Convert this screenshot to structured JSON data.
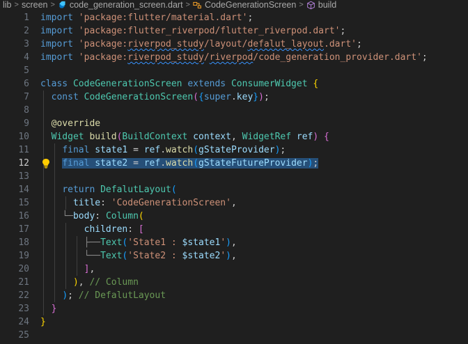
{
  "breadcrumb": {
    "items": [
      {
        "label": "lib",
        "icon": "none"
      },
      {
        "label": "screen",
        "icon": "none"
      },
      {
        "label": "code_generation_screen.dart",
        "icon": "dart-file-icon"
      },
      {
        "label": "CodeGenerationScreen",
        "icon": "class-symbol-icon"
      },
      {
        "label": "build",
        "icon": "method-cube-icon"
      }
    ],
    "separator": ">"
  },
  "editor": {
    "current_line": 12,
    "lines": [
      {
        "n": "1",
        "tokens": [
          [
            "import",
            "k"
          ],
          [
            " ",
            "p"
          ],
          [
            "'package:flutter/material.dart'",
            "s"
          ],
          [
            ";",
            "p"
          ]
        ]
      },
      {
        "n": "2",
        "tokens": [
          [
            "import",
            "k"
          ],
          [
            " ",
            "p"
          ],
          [
            "'package:flutter_riverpod/flutter_riverpod.dart'",
            "s"
          ],
          [
            ";",
            "p"
          ]
        ]
      },
      {
        "n": "3",
        "tokens": [
          [
            "import",
            "k"
          ],
          [
            " ",
            "p"
          ],
          [
            "'package:",
            "s"
          ],
          [
            "riverpod_study",
            "s sq"
          ],
          [
            "/layout/",
            "s"
          ],
          [
            "defalut_layout",
            "s sq"
          ],
          [
            ".dart'",
            "s"
          ],
          [
            ";",
            "p"
          ]
        ]
      },
      {
        "n": "4",
        "tokens": [
          [
            "import",
            "k"
          ],
          [
            " ",
            "p"
          ],
          [
            "'package:",
            "s"
          ],
          [
            "riverpod_study",
            "s sq"
          ],
          [
            "/",
            "s"
          ],
          [
            "riverpod",
            "s sq"
          ],
          [
            "/code_generation_provider.dart'",
            "s"
          ],
          [
            ";",
            "p"
          ]
        ]
      },
      {
        "n": "5",
        "tokens": []
      },
      {
        "n": "6",
        "tokens": [
          [
            "class",
            "k"
          ],
          [
            " ",
            "p"
          ],
          [
            "CodeGenerationScreen",
            "t"
          ],
          [
            " ",
            "p"
          ],
          [
            "extends",
            "k"
          ],
          [
            " ",
            "p"
          ],
          [
            "ConsumerWidget",
            "t"
          ],
          [
            " ",
            "p"
          ],
          [
            "{",
            "b1"
          ]
        ]
      },
      {
        "n": "7",
        "tokens": [
          [
            "  ",
            "p"
          ],
          [
            "const",
            "k"
          ],
          [
            " ",
            "p"
          ],
          [
            "CodeGenerationScreen",
            "t"
          ],
          [
            "(",
            "b2"
          ],
          [
            "{",
            "b3"
          ],
          [
            "super",
            "k"
          ],
          [
            ".",
            "p"
          ],
          [
            "key",
            "v"
          ],
          [
            "}",
            "b3"
          ],
          [
            ")",
            "b2"
          ],
          [
            ";",
            "p"
          ]
        ]
      },
      {
        "n": "8",
        "tokens": []
      },
      {
        "n": "9",
        "tokens": [
          [
            "  ",
            "p"
          ],
          [
            "@override",
            "f"
          ]
        ]
      },
      {
        "n": "10",
        "tokens": [
          [
            "  ",
            "p"
          ],
          [
            "Widget",
            "t"
          ],
          [
            " ",
            "p"
          ],
          [
            "build",
            "f"
          ],
          [
            "(",
            "b2"
          ],
          [
            "BuildContext",
            "t"
          ],
          [
            " ",
            "p"
          ],
          [
            "context",
            "v"
          ],
          [
            ", ",
            "p"
          ],
          [
            "WidgetRef",
            "t"
          ],
          [
            " ",
            "p"
          ],
          [
            "ref",
            "v"
          ],
          [
            ")",
            "b2"
          ],
          [
            " ",
            "p"
          ],
          [
            "{",
            "b2"
          ]
        ]
      },
      {
        "n": "11",
        "tokens": [
          [
            "    ",
            "p"
          ],
          [
            "final",
            "k"
          ],
          [
            " ",
            "p"
          ],
          [
            "state1",
            "v"
          ],
          [
            " = ",
            "p"
          ],
          [
            "ref",
            "v"
          ],
          [
            ".",
            "p"
          ],
          [
            "watch",
            "f"
          ],
          [
            "(",
            "b3"
          ],
          [
            "gStateProvider",
            "v"
          ],
          [
            ")",
            "b3"
          ],
          [
            ";",
            "p"
          ]
        ]
      },
      {
        "n": "12",
        "tokens": [
          [
            "    ",
            "p"
          ],
          [
            "final",
            "k hl-sel"
          ],
          [
            " ",
            "p hl-sel"
          ],
          [
            "state2",
            "v hl-sel"
          ],
          [
            " = ",
            "p hl-sel"
          ],
          [
            "ref",
            "v hl-sel"
          ],
          [
            ".",
            "p hl-sel"
          ],
          [
            "watch",
            "f hl-sel"
          ],
          [
            "(",
            "b3 hl-sel"
          ],
          [
            "gStateFutureProvider",
            "v hl-sel"
          ],
          [
            ")",
            "b3 hl-sel"
          ],
          [
            ";",
            "p hl-sel"
          ]
        ]
      },
      {
        "n": "13",
        "tokens": []
      },
      {
        "n": "14",
        "tokens": [
          [
            "    ",
            "p"
          ],
          [
            "return",
            "k"
          ],
          [
            " ",
            "p"
          ],
          [
            "DefalutLayout",
            "t"
          ],
          [
            "(",
            "b3"
          ]
        ]
      },
      {
        "n": "15",
        "tokens": [
          [
            "      ",
            "p"
          ],
          [
            "title",
            "v"
          ],
          [
            ": ",
            "p"
          ],
          [
            "'CodeGenerationScreen'",
            "s"
          ],
          [
            ",",
            "p"
          ]
        ]
      },
      {
        "n": "16",
        "tokens": [
          [
            "    ",
            "p"
          ],
          [
            "└─",
            "tree"
          ],
          [
            "body",
            "v"
          ],
          [
            ": ",
            "p"
          ],
          [
            "Column",
            "t"
          ],
          [
            "(",
            "b1"
          ]
        ]
      },
      {
        "n": "17",
        "tokens": [
          [
            "        ",
            "p"
          ],
          [
            "children",
            "v"
          ],
          [
            ": ",
            "p"
          ],
          [
            "[",
            "b2"
          ]
        ]
      },
      {
        "n": "18",
        "tokens": [
          [
            "        ",
            "p"
          ],
          [
            "├──",
            "tree"
          ],
          [
            "Text",
            "t"
          ],
          [
            "(",
            "b3"
          ],
          [
            "'State1 : ",
            "s"
          ],
          [
            "$state1",
            "v"
          ],
          [
            "'",
            "s"
          ],
          [
            ")",
            "b3"
          ],
          [
            ",",
            "p"
          ]
        ]
      },
      {
        "n": "19",
        "tokens": [
          [
            "        ",
            "p"
          ],
          [
            "└──",
            "tree"
          ],
          [
            "Text",
            "t"
          ],
          [
            "(",
            "b3"
          ],
          [
            "'State2 : ",
            "s"
          ],
          [
            "$state2",
            "v"
          ],
          [
            "'",
            "s"
          ],
          [
            ")",
            "b3"
          ],
          [
            ",",
            "p"
          ]
        ]
      },
      {
        "n": "20",
        "tokens": [
          [
            "        ",
            "p"
          ],
          [
            "]",
            "b2"
          ],
          [
            ",",
            "p"
          ]
        ]
      },
      {
        "n": "21",
        "tokens": [
          [
            "      ",
            "p"
          ],
          [
            ")",
            "b1"
          ],
          [
            ", ",
            "p"
          ],
          [
            "// Column",
            "c"
          ]
        ]
      },
      {
        "n": "22",
        "tokens": [
          [
            "    ",
            "p"
          ],
          [
            ")",
            "b3"
          ],
          [
            "; ",
            "p"
          ],
          [
            "// DefalutLayout",
            "c"
          ]
        ]
      },
      {
        "n": "23",
        "tokens": [
          [
            "  ",
            "p"
          ],
          [
            "}",
            "b2"
          ]
        ]
      },
      {
        "n": "24",
        "tokens": [
          [
            "}",
            "b1"
          ]
        ]
      },
      {
        "n": "25",
        "tokens": []
      }
    ]
  },
  "colors": {
    "background": "#1f1f1f",
    "selection": "#264f78",
    "keyword": "#569cd6",
    "string": "#ce9178",
    "type": "#4ec9b0"
  }
}
